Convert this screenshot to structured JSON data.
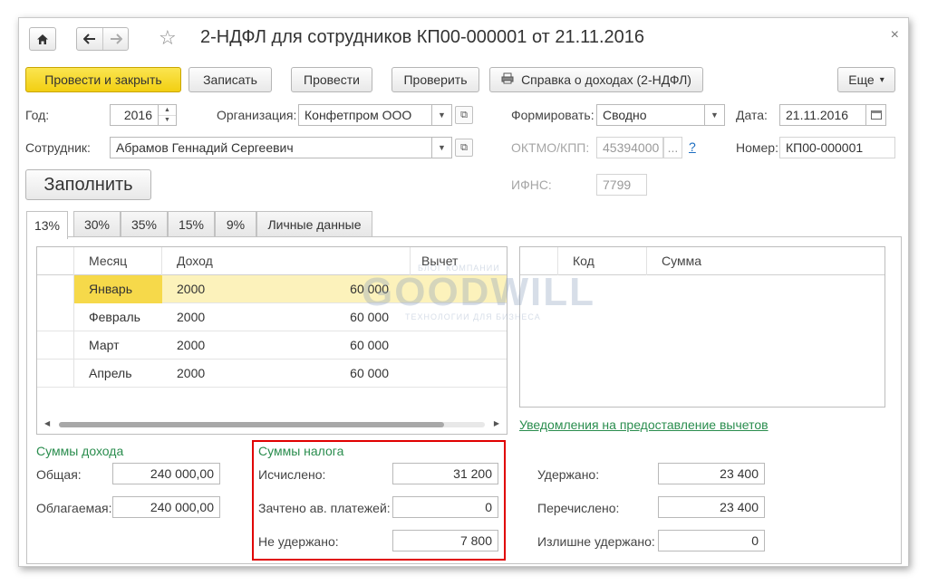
{
  "window": {
    "title": "2-НДФЛ для сотрудников КП00-000001 от 21.11.2016",
    "close_label": "×"
  },
  "nav": {
    "home": "home-icon",
    "back": "arrow-left-icon",
    "forward": "arrow-right-icon",
    "favorite": "star-icon"
  },
  "toolbar": {
    "post_close": "Провести и закрыть",
    "save": "Записать",
    "post": "Провести",
    "check": "Проверить",
    "income_cert": "Справка о доходах (2-НДФЛ)",
    "more": "Еще",
    "more_arrow": "▾"
  },
  "header": {
    "year_label": "Год:",
    "year_value": "2016",
    "org_label": "Организация:",
    "org_value": "Конфетпром ООО",
    "form_label": "Формировать:",
    "form_value": "Сводно",
    "date_label": "Дата:",
    "date_value": "21.11.2016",
    "employee_label": "Сотрудник:",
    "employee_value": "Абрамов Геннадий Сергеевич",
    "oktmo_label": "ОКТМО/КПП:",
    "oktmo_value": "45394000",
    "oktmo_more": "...",
    "help": "?",
    "number_label": "Номер:",
    "number_value": "КП00-000001",
    "ifns_label": "ИФНС:",
    "ifns_value": "7799",
    "fill_button": "Заполнить"
  },
  "tabs": [
    "13%",
    "30%",
    "35%",
    "15%",
    "9%",
    "Личные данные"
  ],
  "income_table": {
    "columns": [
      "Месяц",
      "Доход",
      "Вычет"
    ],
    "rows": [
      {
        "month": "Январь",
        "code": "2000",
        "amount": "60 000"
      },
      {
        "month": "Февраль",
        "code": "2000",
        "amount": "60 000"
      },
      {
        "month": "Март",
        "code": "2000",
        "amount": "60 000"
      },
      {
        "month": "Апрель",
        "code": "2000",
        "amount": "60 000"
      }
    ]
  },
  "deduction_table": {
    "columns": [
      "Код",
      "Сумма"
    ]
  },
  "deduction_link": "Уведомления на предоставление вычетов",
  "income_sums": {
    "title": "Суммы дохода",
    "total_label": "Общая:",
    "total_value": "240 000,00",
    "taxable_label": "Облагаемая:",
    "taxable_value": "240 000,00"
  },
  "tax_sums": {
    "title": "Суммы налога",
    "calculated_label": "Исчислено:",
    "calculated_value": "31 200",
    "offset_label": "Зачтено ав. платежей:",
    "offset_value": "0",
    "not_withheld_label": "Не удержано:",
    "not_withheld_value": "7 800"
  },
  "withheld": {
    "withheld_label": "Удержано:",
    "withheld_value": "23 400",
    "transferred_label": "Перечислено:",
    "transferred_value": "23 400",
    "excess_label": "Излишне удержано:",
    "excess_value": "0"
  },
  "watermark": {
    "top": "БЛОГ КОМПАНИИ",
    "main": "GOODWILL",
    "bottom": "ТЕХНОЛОГИИ ДЛЯ БИЗНЕСА"
  },
  "colors": {
    "primary": "#f4d41f",
    "link": "#2a8d4e",
    "highlight": "#e00000",
    "selected_row": "#fcf2bb"
  }
}
